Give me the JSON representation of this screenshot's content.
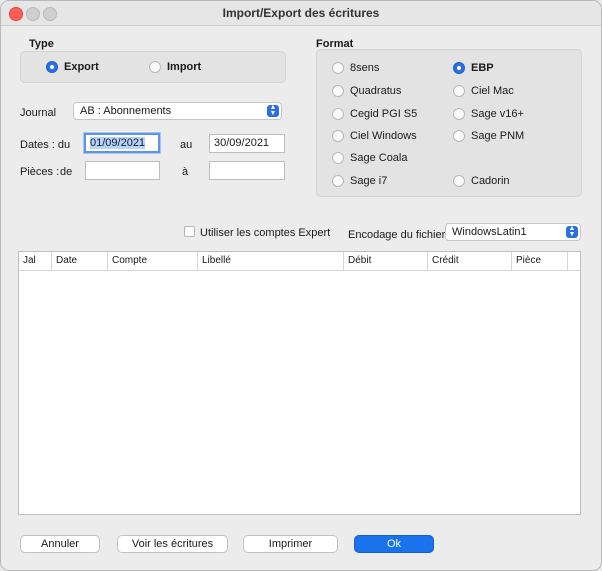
{
  "window": {
    "title": "Import/Export des écritures"
  },
  "type_group": {
    "heading": "Type",
    "options": [
      {
        "label": "Export",
        "selected": true
      },
      {
        "label": "Import",
        "selected": false
      }
    ]
  },
  "format_group": {
    "heading": "Format",
    "options": [
      {
        "label": "8sens",
        "selected": false
      },
      {
        "label": "EBP",
        "selected": true
      },
      {
        "label": "Quadratus",
        "selected": false
      },
      {
        "label": "Ciel Mac",
        "selected": false
      },
      {
        "label": "Cegid PGI S5",
        "selected": false
      },
      {
        "label": "Sage v16+",
        "selected": false
      },
      {
        "label": "Ciel Windows",
        "selected": false
      },
      {
        "label": "Sage PNM",
        "selected": false
      },
      {
        "label": "Sage Coala",
        "selected": false
      },
      {
        "label": "Sage i7",
        "selected": false
      },
      {
        "label": "Cadorin",
        "selected": false
      }
    ]
  },
  "journal": {
    "label": "Journal",
    "value": "AB : Abonnements"
  },
  "dates": {
    "label": "Dates : du",
    "from": "01/09/2021",
    "to_label": "au",
    "to": "30/09/2021"
  },
  "pieces": {
    "label": "Pièces :",
    "de_label": "de",
    "from": "",
    "to_label": "à",
    "to": ""
  },
  "use_expert": {
    "label": "Utiliser les comptes Expert",
    "checked": false
  },
  "encoding": {
    "label": "Encodage du fichier :",
    "value": "WindowsLatin1"
  },
  "table": {
    "columns": [
      "Jal",
      "Date",
      "Compte",
      "Libellé",
      "Débit",
      "Crédit",
      "Pièce"
    ],
    "rows": []
  },
  "buttons": {
    "cancel": "Annuler",
    "view": "Voir les écritures",
    "print": "Imprimer",
    "ok": "Ok"
  },
  "colors": {
    "accent": "#1a73ec",
    "close": "#ff5f57"
  }
}
